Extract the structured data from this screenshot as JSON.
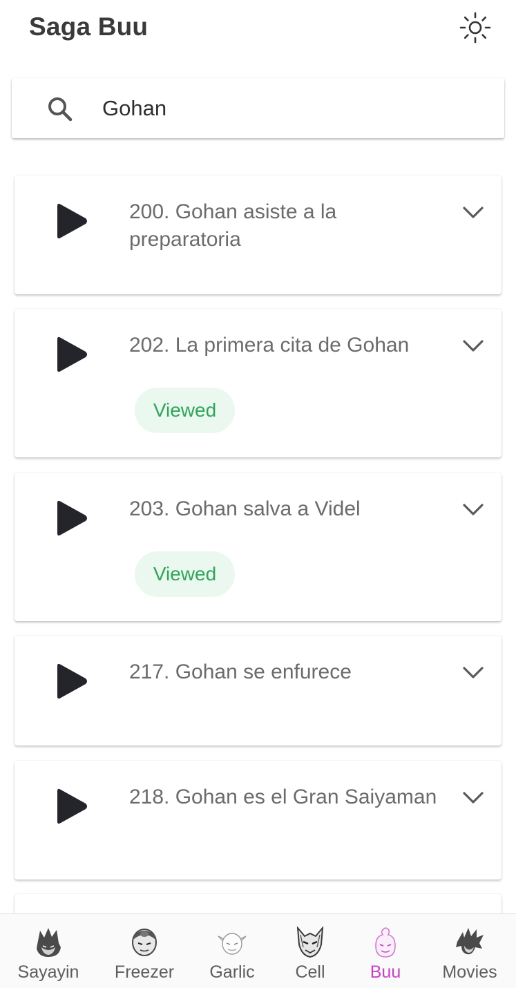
{
  "header": {
    "title": "Saga Buu",
    "theme_icon": "sun-icon"
  },
  "search": {
    "value": "Gohan",
    "icon": "search-icon"
  },
  "episodes": [
    {
      "title": "200. Gohan asiste a la preparatoria",
      "viewed": false
    },
    {
      "title": "202. La primera cita de Gohan",
      "viewed": true,
      "badge": "Viewed"
    },
    {
      "title": "203. Gohan salva a Videl",
      "viewed": true,
      "badge": "Viewed"
    },
    {
      "title": "217. Gohan se enfurece",
      "viewed": false
    },
    {
      "title": "218. Gohan es el Gran Saiyaman",
      "viewed": false
    }
  ],
  "bottom_nav": {
    "items": [
      {
        "label": "Sayayin",
        "icon": "vegeta-icon"
      },
      {
        "label": "Freezer",
        "icon": "freezer-icon"
      },
      {
        "label": "Garlic",
        "icon": "garlic-icon"
      },
      {
        "label": "Cell",
        "icon": "cell-icon"
      },
      {
        "label": "Buu",
        "icon": "buu-icon",
        "active": true
      },
      {
        "label": "Movies",
        "icon": "goku-icon"
      }
    ]
  },
  "colors": {
    "badge_text": "#2fa55a",
    "badge_bg": "#ebf8ef",
    "active_nav": "#c93fc9",
    "icon_dark": "#23252a"
  }
}
